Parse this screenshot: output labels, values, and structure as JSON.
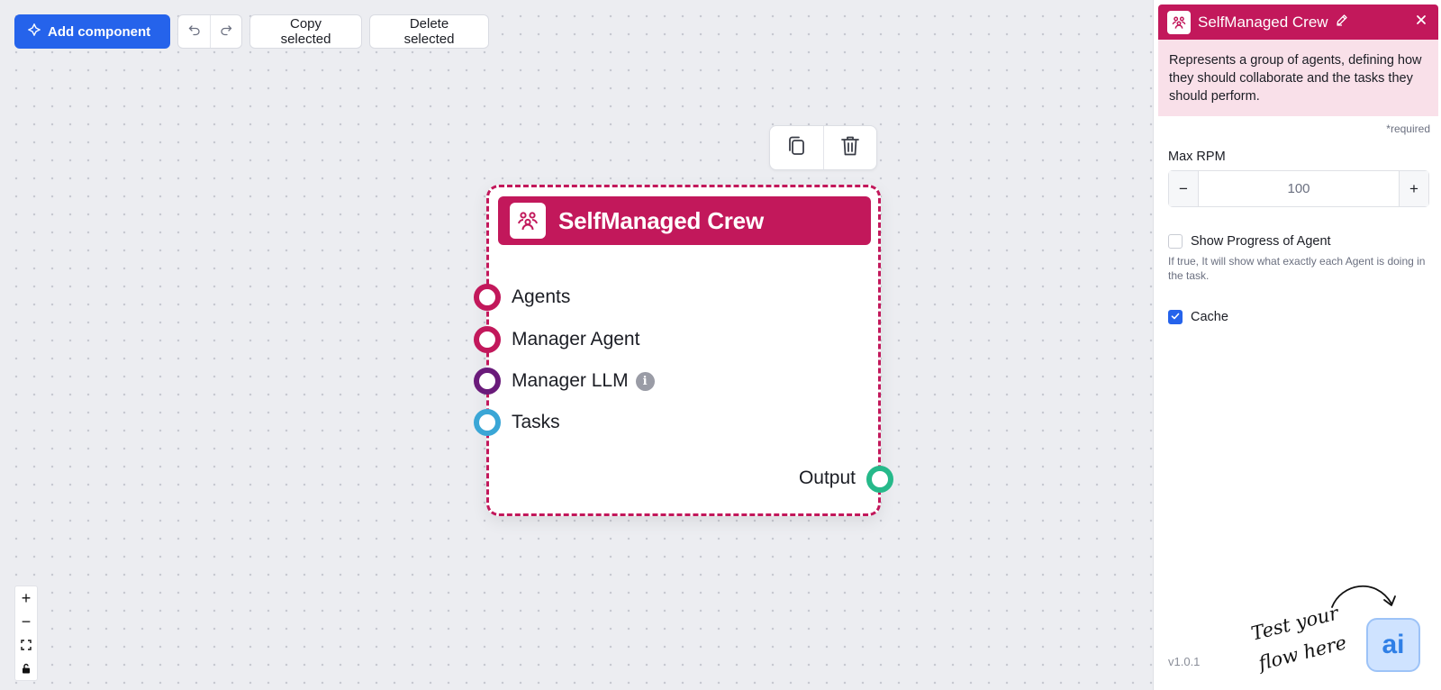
{
  "toolbar": {
    "add_component": "Add component",
    "copy_selected": "Copy selected",
    "delete_selected": "Delete selected"
  },
  "node": {
    "title": "SelfManaged Crew",
    "inputs": [
      {
        "label": "Agents",
        "color": "#c2185b"
      },
      {
        "label": "Manager Agent",
        "color": "#c2185b"
      },
      {
        "label": "Manager LLM",
        "color": "#6a1b7a"
      },
      {
        "label": "Tasks",
        "color": "#3aa6d6"
      }
    ],
    "output": {
      "label": "Output",
      "color": "#26b98a"
    }
  },
  "panel": {
    "title": "SelfManaged Crew",
    "description": "Represents a group of agents, defining how they should collaborate and the tasks they should perform.",
    "required_note": "*required",
    "max_rpm_label": "Max RPM",
    "max_rpm_placeholder": "100",
    "stepper_minus": "−",
    "stepper_plus": "+",
    "show_progress_label": "Show Progress of Agent",
    "show_progress_checked": false,
    "show_progress_help": "If true, It will show what exactly each Agent is doing in the task.",
    "cache_label": "Cache",
    "cache_checked": true,
    "version": "v1.0.1",
    "test_flow_text": "Test your flow here",
    "ai_button_label": "ai"
  },
  "zoom": {
    "zoom_in": "+",
    "zoom_out": "−"
  },
  "colors": {
    "accent": "#c2185b",
    "primary": "#2563eb"
  }
}
